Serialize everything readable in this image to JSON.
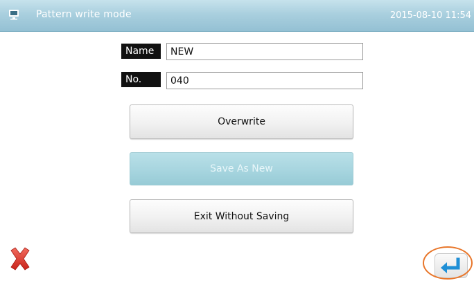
{
  "window": {
    "title": "Pattern write mode",
    "datetime": "2015-08-10 11:54",
    "icon": "screen-icon"
  },
  "form": {
    "name_label": "Name",
    "name_value": "NEW",
    "number_label": "No.",
    "number_value": "040"
  },
  "actions": {
    "overwrite_label": "Overwrite",
    "save_as_new_label": "Save As New",
    "exit_label": "Exit Without Saving"
  },
  "footer": {
    "cancel_icon": "close-icon",
    "enter_icon": "enter-icon",
    "cancel_color": "#e53935",
    "enter_color": "#1f8fd6",
    "highlight_color": "#e8762a"
  }
}
